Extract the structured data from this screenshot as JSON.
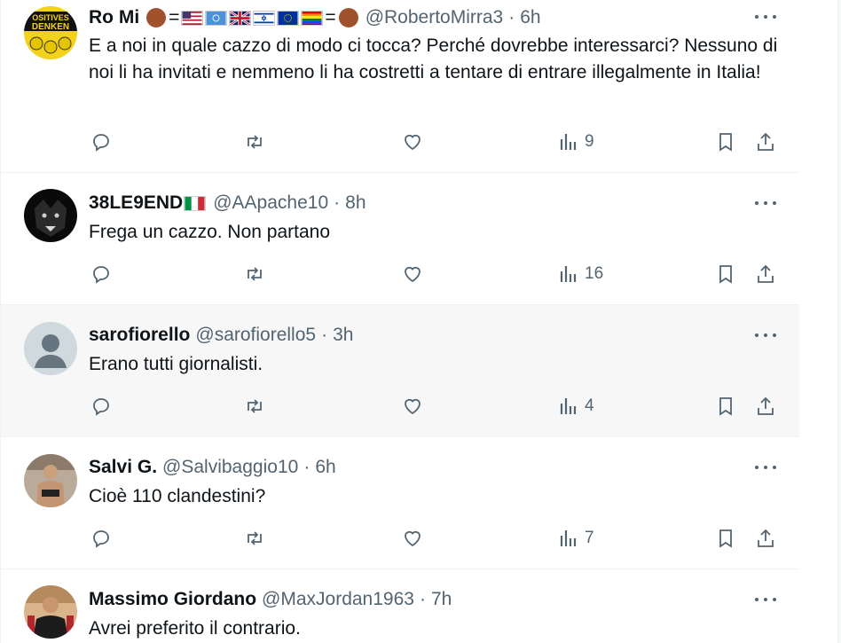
{
  "tweets": [
    {
      "name": "Ro Mi",
      "name_suffix": "=",
      "name_suffix2": "=",
      "handle": "@RobertoMirra3",
      "sep": "·",
      "time": "6h",
      "text": "E a noi in quale cazzo di modo ci tocca? Perché dovrebbe interessarci? Nessuno di noi li ha invitati e nemmeno li ha costretti a tentare di entrare illegalmente in Italia!",
      "views": "9"
    },
    {
      "name": "38LE9END",
      "handle": "@AApache10",
      "sep": "·",
      "time": "8h",
      "text": "Frega un cazzo. Non partano",
      "views": "16"
    },
    {
      "name": "sarofiorello",
      "handle": "@sarofiorello5",
      "sep": "·",
      "time": "3h",
      "text": "Erano tutti giornalisti.",
      "views": "4"
    },
    {
      "name": "Salvi G.",
      "handle": "@Salvibaggio10",
      "sep": "·",
      "time": "6h",
      "text": "Cioè 110 clandestini?",
      "views": "7"
    },
    {
      "name": "Massimo Giordano",
      "handle": "@MaxJordan1963",
      "sep": "·",
      "time": "7h",
      "text": "Avrei preferito il contrario."
    }
  ],
  "colors": {
    "muted": "#536471",
    "text": "#0f1419",
    "border": "#eff3f4",
    "hover": "#f7f7f7"
  },
  "icons": [
    "reply-icon",
    "repost-icon",
    "like-icon",
    "views-icon",
    "bookmark-icon",
    "share-icon",
    "more-icon"
  ]
}
